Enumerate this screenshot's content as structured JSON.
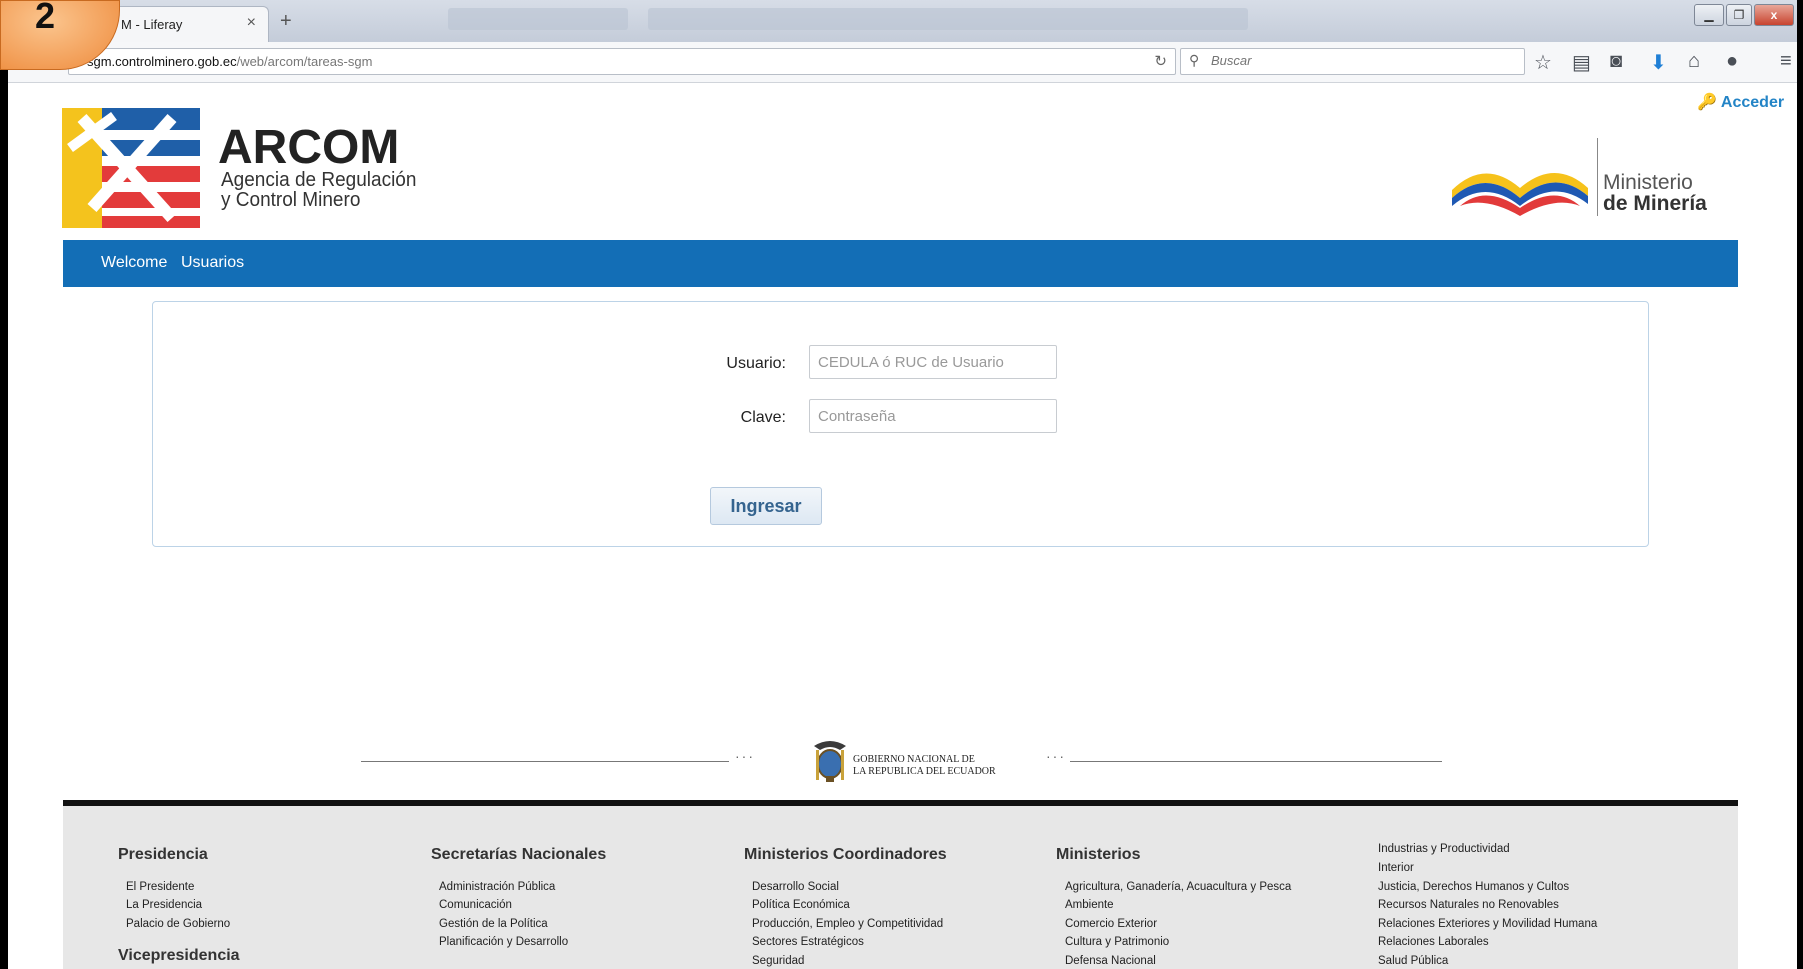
{
  "browser": {
    "tab_title": "M - Liferay",
    "url_host": "sgm.controlminero.gob.ec",
    "url_path": "/web/arcom/tareas-sgm",
    "search_placeholder": "Buscar"
  },
  "step_badge": "2",
  "header": {
    "acceder": "Acceder",
    "brand_title": "ARCOM",
    "brand_sub_1": "Agencia de Regulación",
    "brand_sub_2": "y Control Minero",
    "ministry_1": "Ministerio",
    "ministry_2": "de Minería"
  },
  "menu": {
    "items": [
      "Welcome",
      "Usuarios"
    ]
  },
  "login": {
    "user_label": "Usuario:",
    "user_placeholder": "CEDULA ó RUC de Usuario",
    "pass_label": "Clave:",
    "pass_placeholder": "Contraseña",
    "submit": "Ingresar"
  },
  "gov": {
    "line1": "GOBIERNO NACIONAL DE",
    "line2": "LA REPUBLICA DEL ECUADOR"
  },
  "footer": {
    "presidencia": {
      "title": "Presidencia",
      "links": [
        "El Presidente",
        "La Presidencia",
        "Palacio de Gobierno"
      ]
    },
    "vicepresidencia": {
      "title": "Vicepresidencia"
    },
    "secretarias": {
      "title": "Secretarías Nacionales",
      "links": [
        "Administración Pública",
        "Comunicación",
        "Gestión de la Política",
        "Planificación y Desarrollo"
      ]
    },
    "coordinadores": {
      "title": "Ministerios Coordinadores",
      "links": [
        "Desarrollo Social",
        "Política Económica",
        "Producción, Empleo y Competitividad",
        "Sectores Estratégicos",
        "Seguridad"
      ]
    },
    "ministerios": {
      "title": "Ministerios",
      "links": [
        "Agricultura, Ganadería, Acuacultura y Pesca",
        "Ambiente",
        "Comercio Exterior",
        "Cultura y Patrimonio",
        "Defensa Nacional"
      ]
    },
    "ministerios2": {
      "links": [
        "Industrias y Productividad",
        "Interior",
        "Justicia, Derechos Humanos y Cultos",
        "Recursos Naturales no Renovables",
        "Relaciones Exteriores y Movilidad Humana",
        "Relaciones Laborales",
        "Salud Pública"
      ]
    }
  }
}
